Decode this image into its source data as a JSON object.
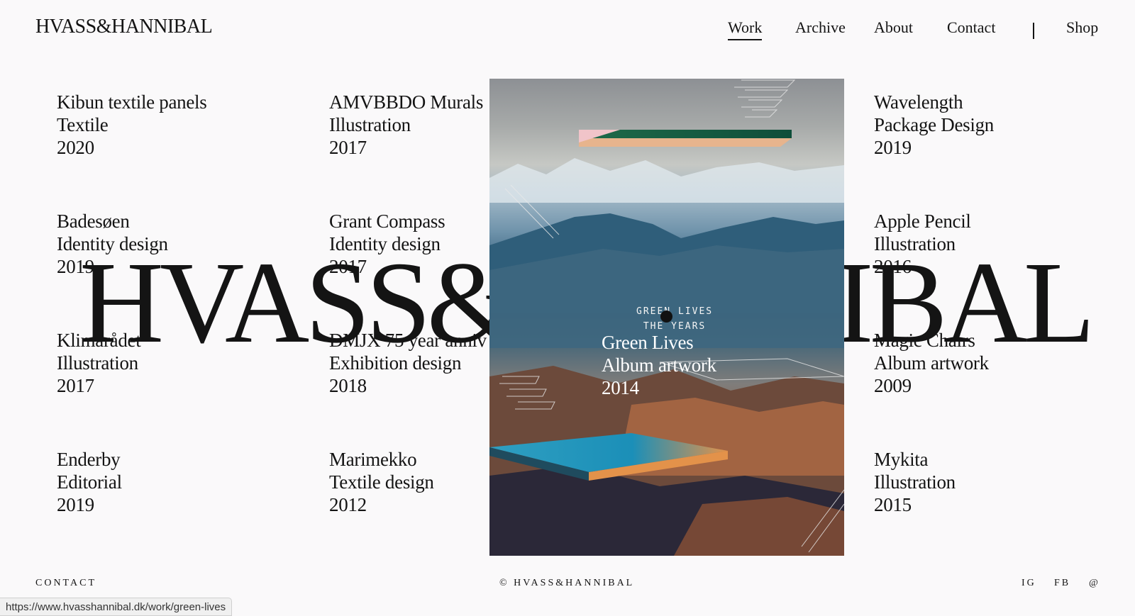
{
  "logo": "HVASS&HANNIBAL",
  "nav": {
    "work": "Work",
    "archive": "Archive",
    "about": "About",
    "contact": "Contact",
    "shop": "Shop"
  },
  "big_title": "HVASS&HANNIBAL",
  "projects": [
    {
      "title": "Kibun textile panels",
      "category": "Textile",
      "year": "2020"
    },
    {
      "title": "AMVBBDO Murals",
      "category": "Illustration",
      "year": "2017"
    },
    {
      "title": "Wavelength",
      "category": "Package Design",
      "year": "2019"
    },
    {
      "title": "Badesøen",
      "category": "Identity design",
      "year": "2019"
    },
    {
      "title": "Grant Compass",
      "category": "Identity design",
      "year": "2017"
    },
    {
      "title": "Apple Pencil",
      "category": "Illustration",
      "year": "2016"
    },
    {
      "title": "Klimarådet",
      "category": "Illustration",
      "year": "2017"
    },
    {
      "title": "DMJX 75 year anniv",
      "category": "Exhibition design",
      "year": "2018"
    },
    {
      "title": "Magic Chairs",
      "category": "Album artwork",
      "year": "2009"
    },
    {
      "title": "Enderby",
      "category": "Editorial",
      "year": "2019"
    },
    {
      "title": "Marimekko",
      "category": "Textile design",
      "year": "2012"
    },
    {
      "title": "Mykita",
      "category": "Illustration",
      "year": "2015"
    }
  ],
  "hovered": {
    "poster_line1": "GREEN LIVES",
    "poster_line2": "THE YEARS",
    "title": "Green Lives",
    "category": "Album artwork",
    "year": "2014"
  },
  "footer": {
    "contact": "CONTACT",
    "copyright": "©  HVASS&HANNIBAL",
    "ig": "IG",
    "fb": "FB",
    "email": "@"
  },
  "status_url": "https://www.hvasshannibal.dk/work/green-lives",
  "colors": {
    "background": "#faf9fa",
    "text": "#141414",
    "accent_green": "#1e6b4a",
    "accent_blue": "#2f9fc1",
    "accent_orange": "#e3924a"
  }
}
